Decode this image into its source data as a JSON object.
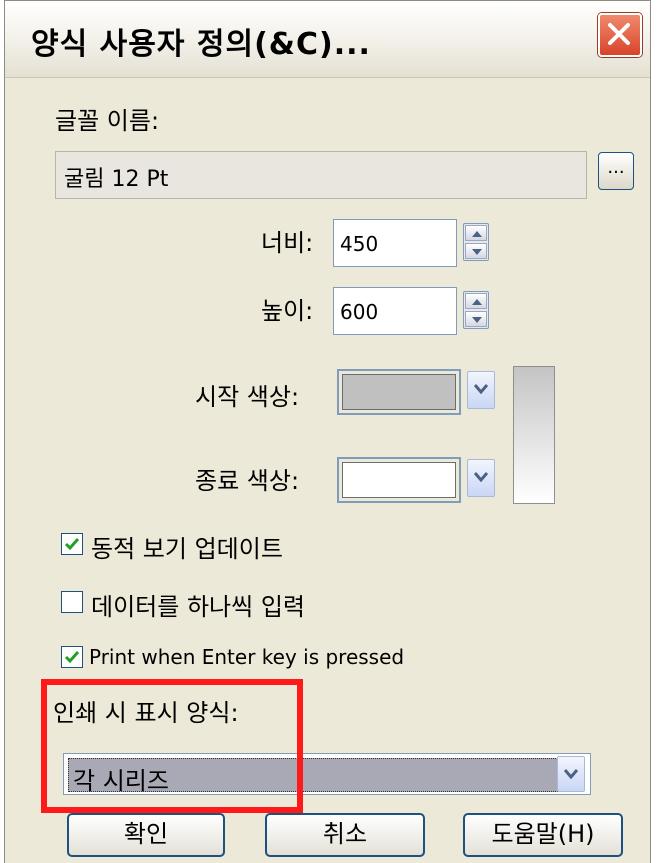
{
  "dialog": {
    "title": "양식 사용자 정의(&C)...",
    "close_icon": "close-icon"
  },
  "font": {
    "label": "글꼴 이름:",
    "value": "굴림 12 Pt",
    "browse_label": "..."
  },
  "size": {
    "width_label": "너비:",
    "width_value": "450",
    "height_label": "높이:",
    "height_value": "600"
  },
  "colors": {
    "start_label": "시작 색상:",
    "start_color": "#c0c0c0",
    "end_label": "종료 색상:",
    "end_color": "#ffffff"
  },
  "options": {
    "dynamic_preview": {
      "label": "동적 보기 업데이트",
      "checked": true
    },
    "enter_one_by_one": {
      "label": "데이터를 하나씩 입력",
      "checked": false
    },
    "print_on_enter": {
      "label": "Print when Enter key is pressed",
      "checked": true
    }
  },
  "print_format": {
    "label": "인쇄 시 표시 양식:",
    "selected": "각 시리즈"
  },
  "buttons": {
    "ok": "확인",
    "cancel": "취소",
    "help": "도움말(H)"
  },
  "accent_colors": {
    "highlight_frame": "#ff1a1a",
    "check": "#21a121"
  }
}
